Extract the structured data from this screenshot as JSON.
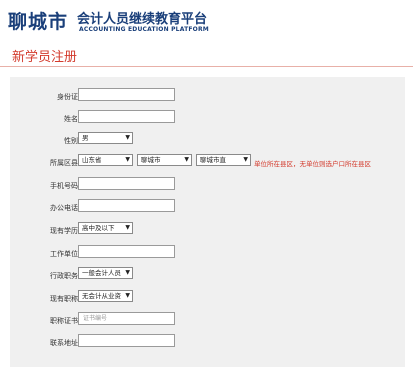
{
  "header": {
    "city": "聊城市",
    "platform_cn": "会计人员继续教育平台",
    "platform_en": "ACCOUNTING EDUCATION PLATFORM"
  },
  "page_title": "新学员注册",
  "form": {
    "id_label": "身份证",
    "id_value": "",
    "name_label": "姓名",
    "name_value": "",
    "gender_label": "性别",
    "gender_value": "男",
    "region_label": "所属区县",
    "province_value": "山东省",
    "city_value": "聊城市",
    "district_value": "聊城市直",
    "region_hint": "单位所在县区，无单位则选户口所在县区",
    "mobile_label": "手机号码",
    "mobile_value": "",
    "office_phone_label": "办公电话",
    "office_phone_value": "",
    "education_label": "现有学历",
    "education_value": "高中及以下",
    "employer_label": "工作单位",
    "employer_value": "",
    "position_label": "行政职务",
    "position_value": "一般会计人员",
    "title_label": "现有职称",
    "title_value": "无会计从业资",
    "certificate_label": "职称证书",
    "certificate_placeholder": "证书编号",
    "address_label": "联系地址",
    "address_value": ""
  }
}
